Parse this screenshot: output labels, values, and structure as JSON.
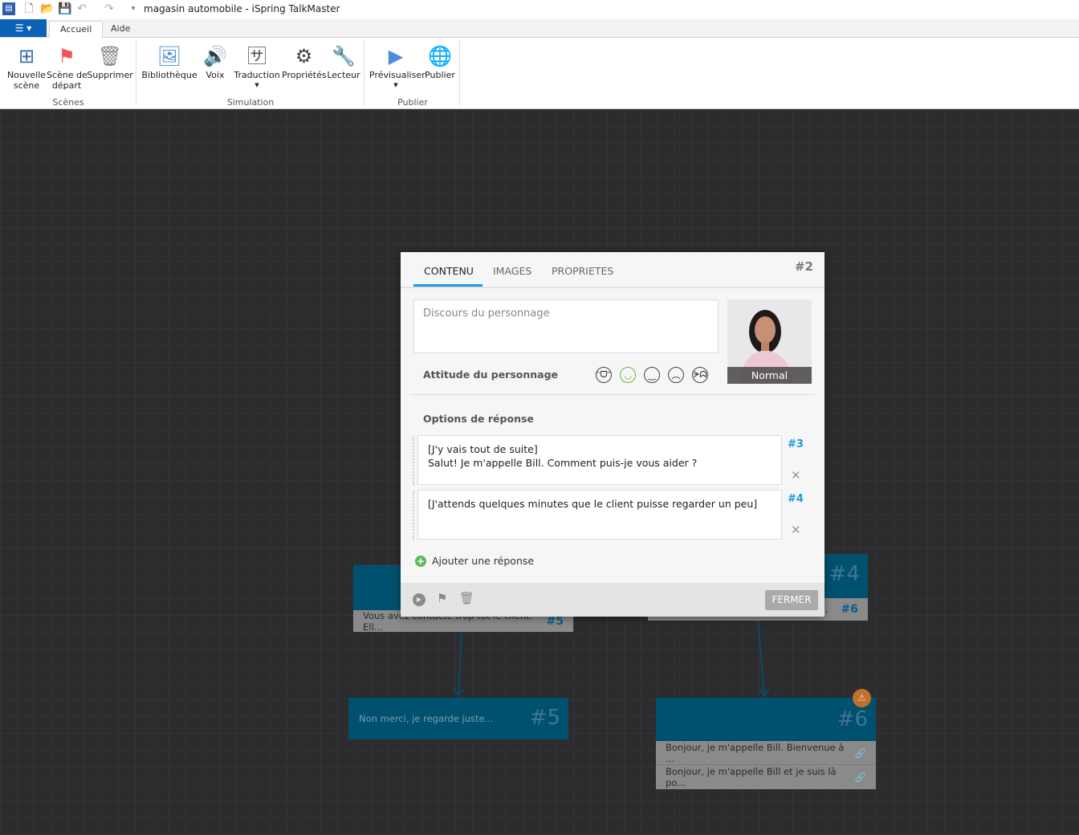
{
  "window": {
    "title": "magasin automobile - iSpring TalkMaster"
  },
  "ribbon": {
    "tabs": [
      {
        "label": "Accueil"
      },
      {
        "label": "Aide"
      }
    ],
    "buttons": {
      "new_scene": "Nouvelle\nscène",
      "start_scene": "Scène de\ndépart",
      "delete": "Supprimer",
      "library": "Bibliothèque",
      "voice": "Voix",
      "translation": "Traduction",
      "properties": "Propriétés",
      "player": "Lecteur",
      "preview": "Prévisualiser",
      "publish": "Publier"
    },
    "groups": {
      "scenes": "Scènes",
      "simulation": "Simulation",
      "publish": "Publier"
    }
  },
  "canvas": {
    "nodes": {
      "left_row": "Vous avez contacté trop tôt le client. Ell...",
      "left_row_link": "#5",
      "n4": "#4",
      "n4_row": "...",
      "n4_row_link": "#6",
      "n5_text": "Non merci, je regarde juste...",
      "n5": "#5",
      "n6": "#6",
      "n6_rows": [
        "Bonjour, je m'appelle Bill. Bienvenue à ...",
        "Bonjour, je m'appelle Bill et je suis là po..."
      ]
    }
  },
  "dialog": {
    "id": "#2",
    "tabs": [
      "CONTENU",
      "IMAGES",
      "PROPRIETES"
    ],
    "speech_placeholder": "Discours du personnage",
    "attitude_label": "Attitude du personnage",
    "attitude_selected": "smile",
    "character_state": "Normal",
    "options_label": "Options de réponse",
    "options": [
      {
        "text1": "[J'y vais tout de suite]",
        "text2": "Salut! Je m'appelle Bill. Comment puis-je vous aider ?",
        "target": "#3"
      },
      {
        "text1": "[J'attends quelques minutes que le client puisse regarder un peu]",
        "text2": "",
        "target": "#4"
      }
    ],
    "add_response": "Ajouter une réponse",
    "close": "FERMER"
  },
  "colors": {
    "accent": "#1a9be0",
    "node_header": "#00506f",
    "app_button": "#0b63b7",
    "warning": "#c2702a"
  }
}
